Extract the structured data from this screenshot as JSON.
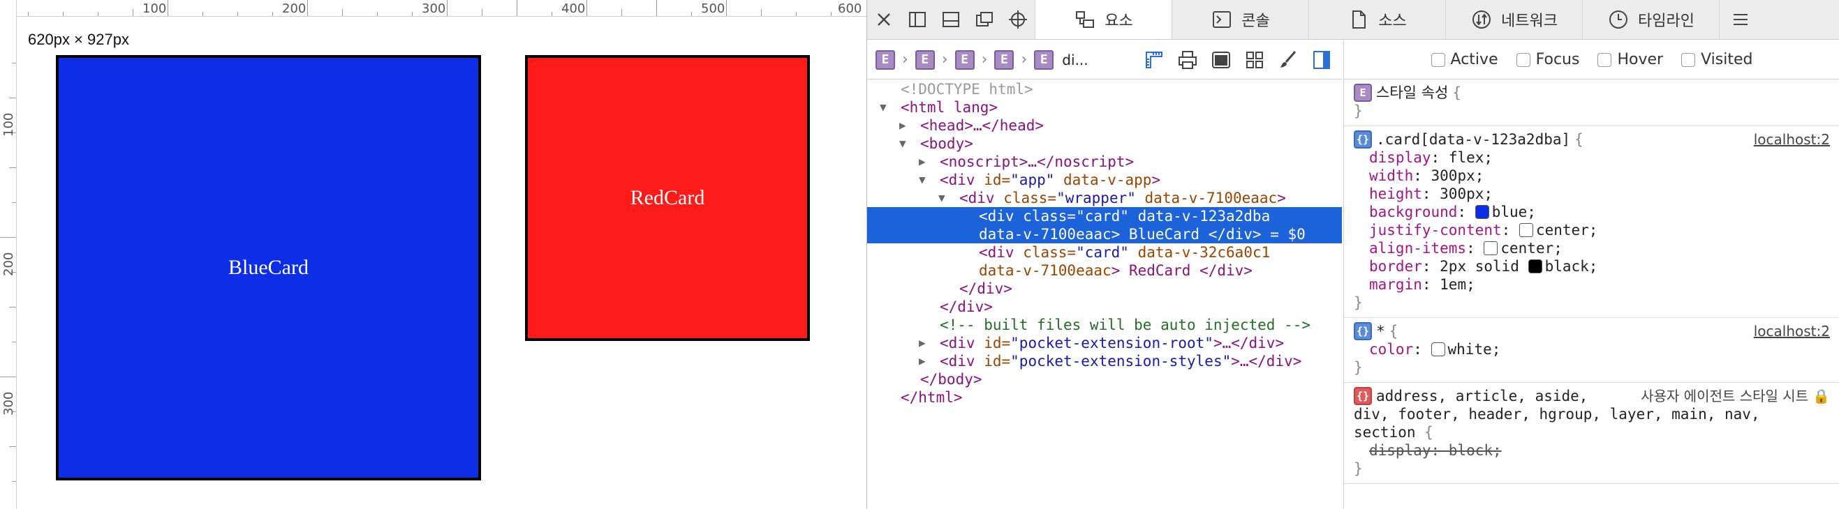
{
  "preview": {
    "dimensions": "620px × 927px",
    "ruler_top_labels": [
      "100",
      "200",
      "300",
      "400",
      "500",
      "600"
    ],
    "ruler_left_labels": [
      "100",
      "200",
      "300"
    ],
    "blue_card_text": "BlueCard",
    "red_card_text": "RedCard",
    "colors": {
      "blue_card": "#0d2ee6",
      "red_card": "#ff1a1a",
      "border": "#000000"
    }
  },
  "tabs": [
    {
      "label": "요소",
      "icon": "elements-icon",
      "active": true
    },
    {
      "label": "콘솔",
      "icon": "console-icon",
      "active": false
    },
    {
      "label": "소스",
      "icon": "sources-icon",
      "active": false
    },
    {
      "label": "네트워크",
      "icon": "network-icon",
      "active": false
    },
    {
      "label": "타임라인",
      "icon": "timeline-icon",
      "active": false
    }
  ],
  "breadcrumb": {
    "items": [
      "E",
      "E",
      "E",
      "E",
      "E"
    ],
    "last_label": "di..."
  },
  "dom": {
    "doctype": "<!DOCTYPE html>",
    "html_open": "<html lang>",
    "head": "<head>…</head>",
    "body_open": "<body>",
    "noscript": "<noscript>…</noscript>",
    "app_tag": "<div",
    "app_attr1_name": " id=",
    "app_attr1_val": "\"app\"",
    "app_attr2": " data-v-app",
    "app_close": ">",
    "wrapper_tag": "<div",
    "wrapper_attr1_name": " class=",
    "wrapper_attr1_val": "\"wrapper\"",
    "wrapper_attr2": " data-v-7100eaac",
    "wrapper_close": ">",
    "blue_line1": "<div class=\"card\" data-v-123a2dba",
    "blue_line2": "data-v-7100eaac> BlueCard </div> = $0",
    "red_tag": "<div",
    "red_attr1_name": " class=",
    "red_attr1_val": "\"card\"",
    "red_attr2": " data-v-32c6a0c1",
    "red_attr3": "data-v-7100eaac",
    "red_text": "> RedCard </div>",
    "div_close_1": "</div>",
    "div_close_2": "</div>",
    "comment": "<!-- built files will be auto injected -->",
    "pocket_root_tag": "<div",
    "pocket_root_attr_name": " id=",
    "pocket_root_attr_val": "\"pocket-extension-root\"",
    "pocket_root_rest": ">…</div>",
    "pocket_styles_tag": "<div",
    "pocket_styles_attr_name": " id=",
    "pocket_styles_attr_val": "\"pocket-extension-styles\"",
    "pocket_styles_rest": ">…</div>",
    "body_close": "</body>",
    "html_close": "</html>"
  },
  "pseudo_classes": [
    "Active",
    "Focus",
    "Hover",
    "Visited"
  ],
  "styles": {
    "element_style": {
      "title": "스타일 속성",
      "open": "{",
      "close": "}"
    },
    "card_rule": {
      "selector": ".card[data-v-123a2dba]",
      "open": "{",
      "close": "}",
      "origin": "localhost:2",
      "decls": [
        {
          "prop": "display",
          "val": "flex;"
        },
        {
          "prop": "width",
          "val": "300px;"
        },
        {
          "prop": "height",
          "val": "300px;"
        },
        {
          "prop": "background",
          "val": "blue;",
          "swatch": "#0d2ee6"
        },
        {
          "prop": "justify-content",
          "val": "center;",
          "flexicon": true
        },
        {
          "prop": "align-items",
          "val": "center;",
          "flexicon": true
        },
        {
          "prop": "border",
          "val": "2px solid ",
          "val2": "black;",
          "swatch2": "#000000"
        },
        {
          "prop": "margin",
          "val": "1em;"
        }
      ]
    },
    "star_rule": {
      "selector": "*",
      "open": "{",
      "close": "}",
      "origin": "localhost:2",
      "decl_prop": "color",
      "decl_val": "white;",
      "swatch": "#ffffff"
    },
    "ua_rule": {
      "selector_line1": "address, article, aside,",
      "selector_line2": "div, footer, header, hgroup, layer, main, nav,",
      "selector_line3": "section",
      "open": "{",
      "close": "}",
      "origin": "사용자 에이전트 스타일 시트",
      "decl": "display: block;"
    }
  }
}
